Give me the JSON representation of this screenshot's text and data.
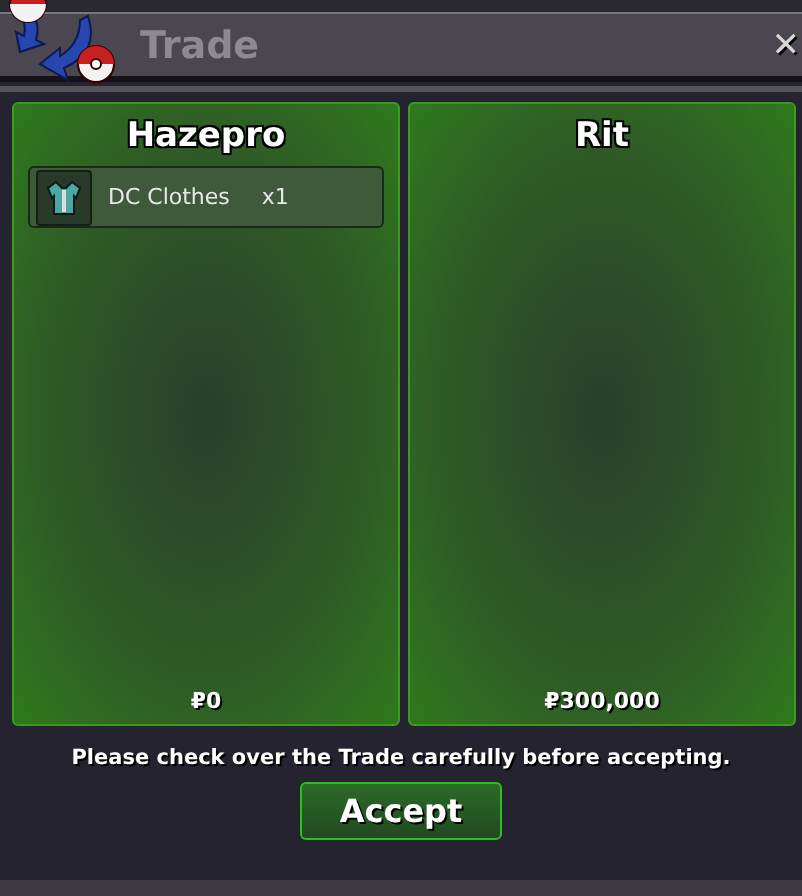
{
  "window": {
    "title": "Trade",
    "close": "✕"
  },
  "traders": [
    {
      "name": "Hazepro",
      "items": [
        {
          "name": "DC Clothes",
          "quantity": "x1"
        }
      ],
      "money": "₽0"
    },
    {
      "name": "Rit",
      "money": "₽300,000"
    }
  ],
  "message": "Please check over the Trade carefully before accepting.",
  "accept_button": "Accept"
}
